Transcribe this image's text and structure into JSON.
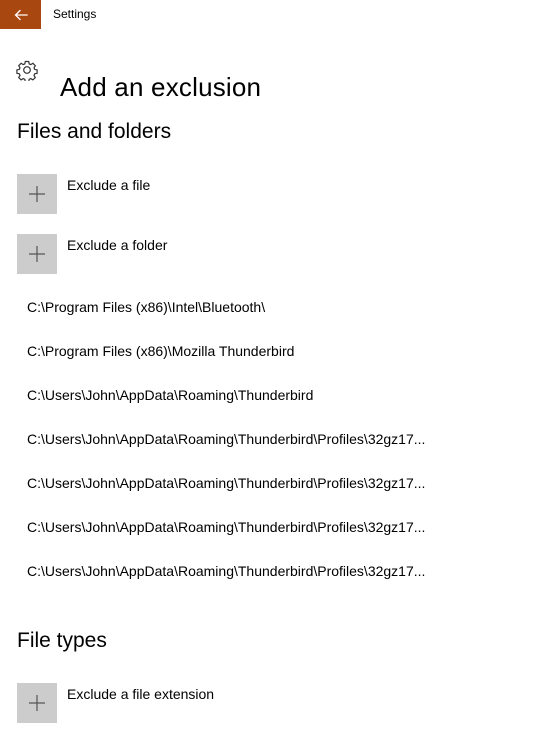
{
  "window": {
    "title": "Settings"
  },
  "colors": {
    "accent": "#a8470f",
    "tile": "#cccccc"
  },
  "header": {
    "icon": "gear-icon",
    "title": "Add an exclusion"
  },
  "files_and_folders": {
    "heading": "Files and folders",
    "add_file_label": "Exclude a file",
    "add_folder_label": "Exclude a folder",
    "items": [
      "C:\\Program Files (x86)\\Intel\\Bluetooth\\",
      "C:\\Program Files (x86)\\Mozilla Thunderbird",
      "C:\\Users\\John\\AppData\\Roaming\\Thunderbird",
      "C:\\Users\\John\\AppData\\Roaming\\Thunderbird\\Profiles\\32gz17...",
      "C:\\Users\\John\\AppData\\Roaming\\Thunderbird\\Profiles\\32gz17...",
      "C:\\Users\\John\\AppData\\Roaming\\Thunderbird\\Profiles\\32gz17...",
      "C:\\Users\\John\\AppData\\Roaming\\Thunderbird\\Profiles\\32gz17..."
    ]
  },
  "file_types": {
    "heading": "File types",
    "add_extension_label": "Exclude a file extension"
  }
}
